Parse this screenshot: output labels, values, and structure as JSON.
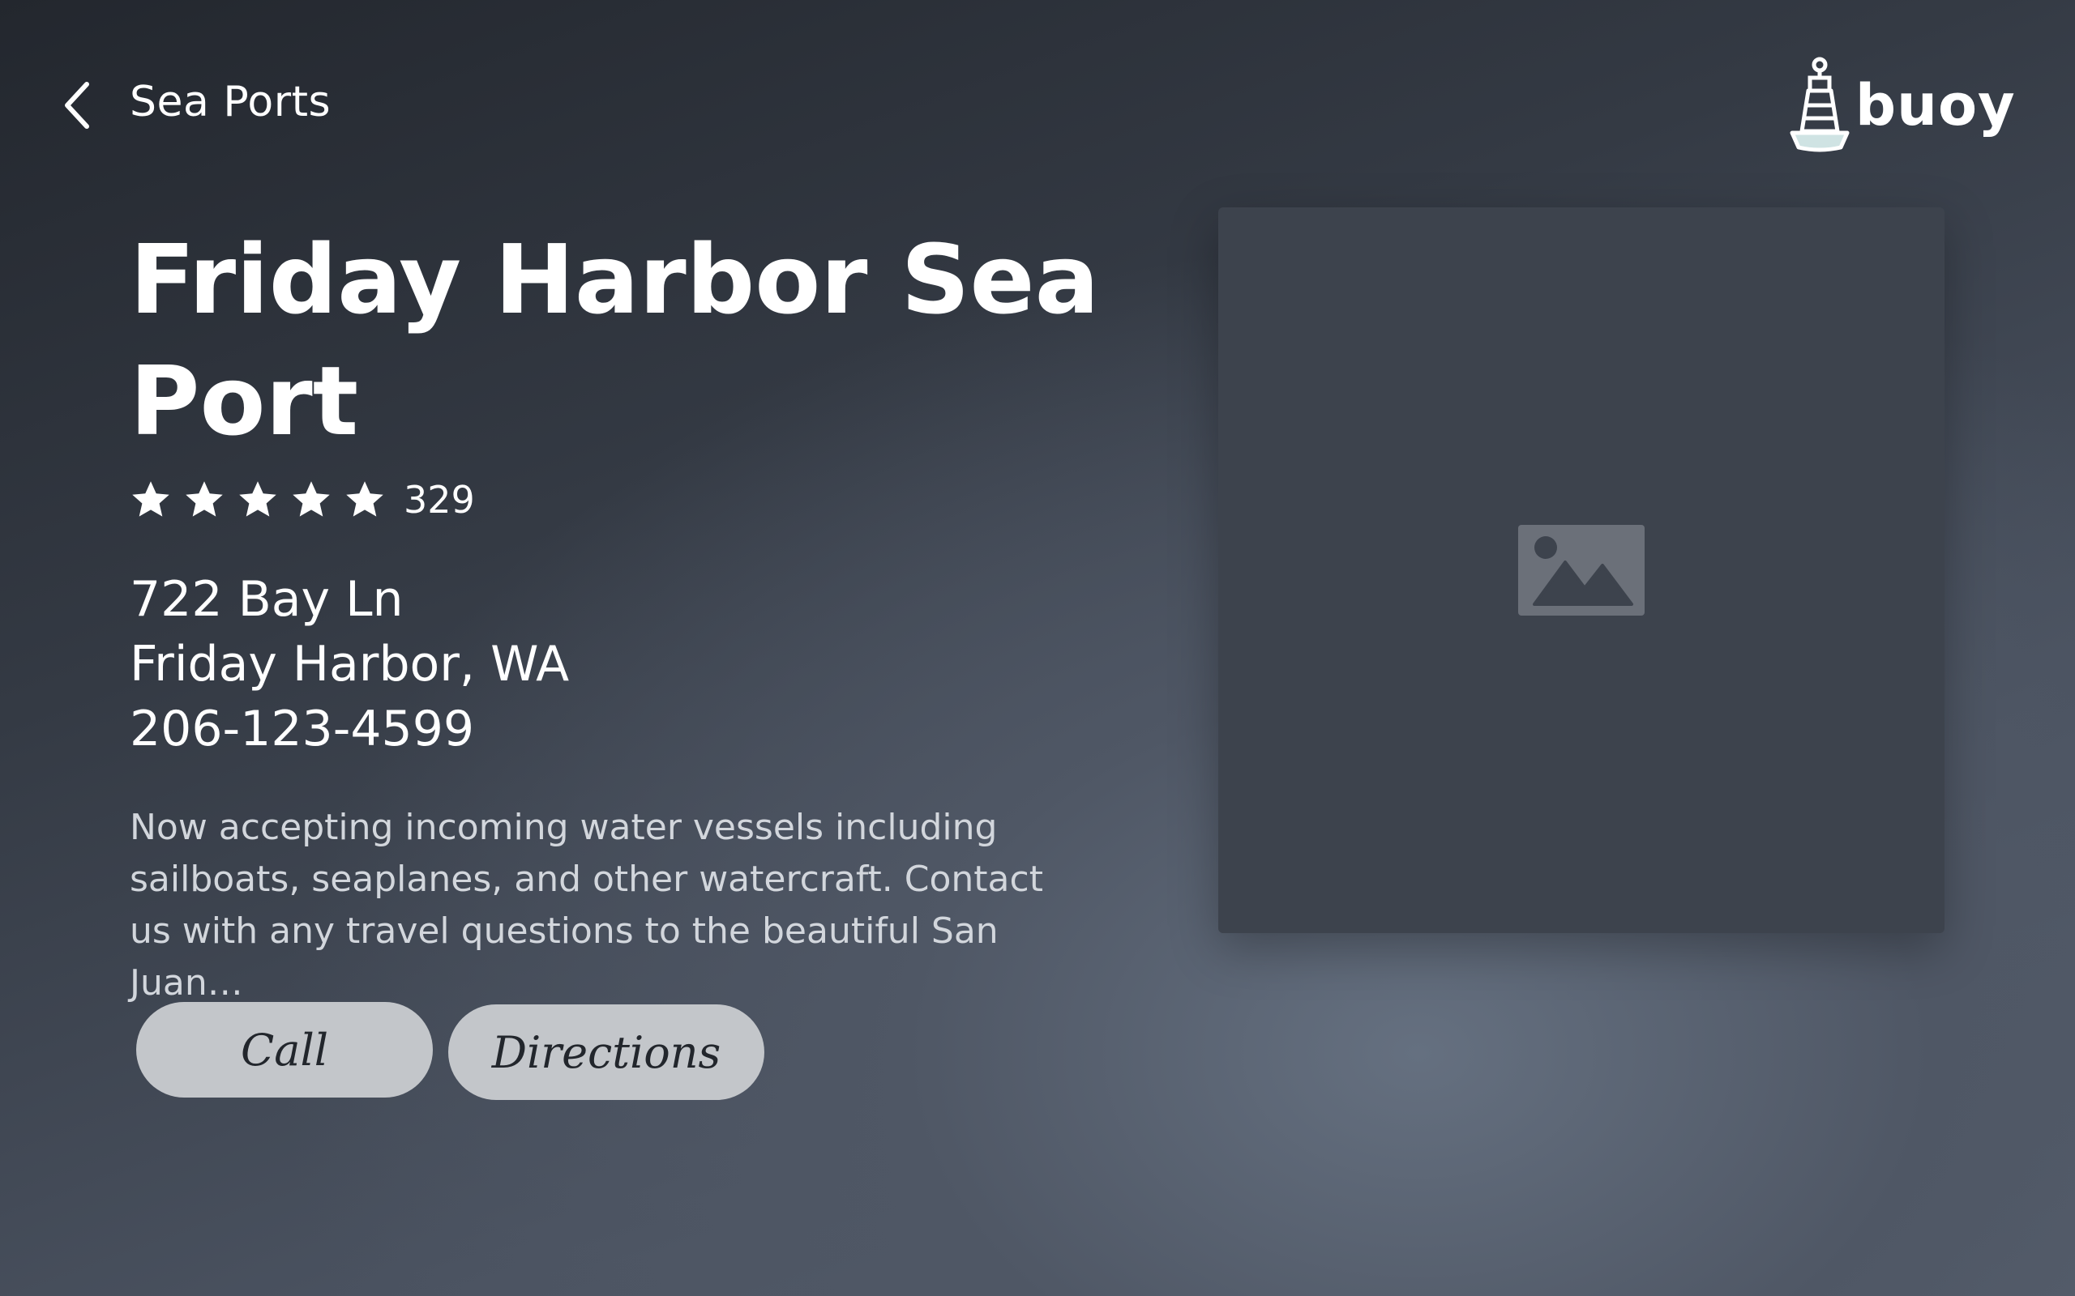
{
  "header": {
    "back_icon": "chevron-left-icon",
    "breadcrumb": "Sea Ports",
    "logo_text": "buoy",
    "logo_icon": "buoy-icon"
  },
  "place": {
    "title": "Friday Harbor Sea Port",
    "rating": {
      "stars": 5,
      "max": 5,
      "count": "329"
    },
    "address_line1": "722 Bay Ln",
    "address_line2": "Friday Harbor, WA",
    "phone": "206-123-4599",
    "description": "Now accepting incoming water vessels including sailboats, seaplanes, and other watercraft. Contact us with any travel questions to the beautiful San Juan…"
  },
  "actions": {
    "call_label": "Call",
    "directions_label": "Directions"
  },
  "media": {
    "placeholder_icon": "image-placeholder-icon"
  },
  "colors": {
    "button_bg": "#c3c6ca",
    "button_text": "#22262c",
    "card_bg": "#3d434d",
    "logo_accent": "#cfe3e3"
  }
}
